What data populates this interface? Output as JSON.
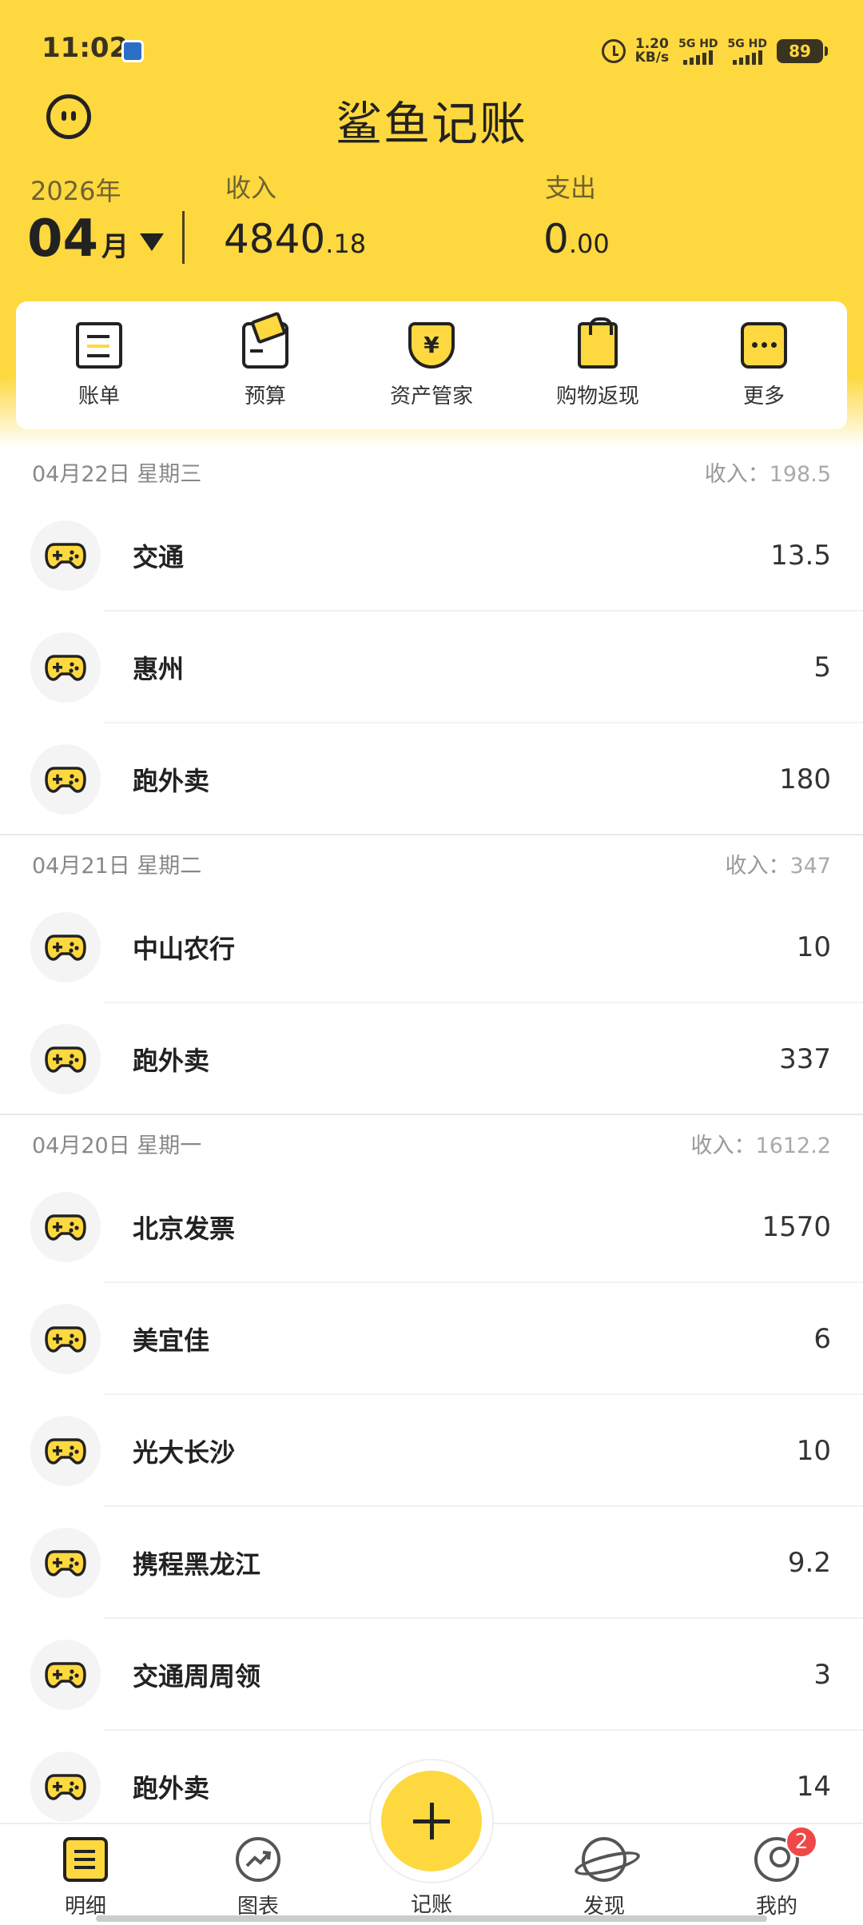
{
  "status": {
    "time": "11:02",
    "net_speed_value": "1.20",
    "net_speed_unit": "KB/s",
    "sim1_label": "5G HD",
    "sim2_label": "5G HD",
    "battery": "89"
  },
  "header": {
    "title": "鲨鱼记账",
    "year": "2026年",
    "month": "04",
    "month_unit": "月",
    "income_label": "收入",
    "income_int": "4840",
    "income_dec": ".18",
    "expense_label": "支出",
    "expense_int": "0",
    "expense_dec": ".00"
  },
  "shortcuts": [
    {
      "label": "账单",
      "icon": "bill-icon"
    },
    {
      "label": "预算",
      "icon": "budget-icon"
    },
    {
      "label": "资产管家",
      "icon": "asset-shield-icon"
    },
    {
      "label": "购物返现",
      "icon": "shopping-bag-icon"
    },
    {
      "label": "更多",
      "icon": "more-icon"
    }
  ],
  "asset_symbol": "¥",
  "days": [
    {
      "date": "04月22日 星期三",
      "sum_label": "收入：",
      "sum_value": "198.5",
      "entries": [
        {
          "name": "交通",
          "amount": "13.5"
        },
        {
          "name": "惠州",
          "amount": "5"
        },
        {
          "name": "跑外卖",
          "amount": "180"
        }
      ]
    },
    {
      "date": "04月21日 星期二",
      "sum_label": "收入：",
      "sum_value": "347",
      "entries": [
        {
          "name": "中山农行",
          "amount": "10"
        },
        {
          "name": "跑外卖",
          "amount": "337"
        }
      ]
    },
    {
      "date": "04月20日 星期一",
      "sum_label": "收入：",
      "sum_value": "1612.2",
      "entries": [
        {
          "name": "北京发票",
          "amount": "1570"
        },
        {
          "name": "美宜佳",
          "amount": "6"
        },
        {
          "name": "光大长沙",
          "amount": "10"
        },
        {
          "name": "携程黑龙江",
          "amount": "9.2"
        },
        {
          "name": "交通周周领",
          "amount": "3"
        },
        {
          "name": "跑外卖",
          "amount": "14"
        }
      ]
    }
  ],
  "entry_icon": "gamepad-icon",
  "nav": {
    "detail": "明细",
    "chart": "图表",
    "record": "记账",
    "discover": "发现",
    "me": "我的",
    "me_badge": "2"
  },
  "colors": {
    "brand_yellow": "#FED83F",
    "badge_red": "#F04848"
  }
}
